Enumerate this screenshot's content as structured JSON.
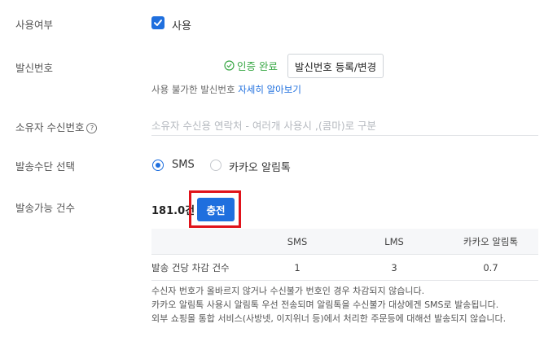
{
  "fields": {
    "usage_label": "사용여부",
    "sender_label": "발신번호",
    "owner_label": "소유자 수신번호",
    "method_label": "발송수단 선택",
    "count_label": "발송가능 건수"
  },
  "usage": {
    "checked": true,
    "checkbox_label": "사용"
  },
  "sender": {
    "status": "인증 완료",
    "register_button": "발신번호 등록/변경",
    "help_text": "사용 불가한 발신번호",
    "help_link": "자세히 알아보기"
  },
  "owner_input": {
    "value": "",
    "placeholder": "소유자 수신용 연락처 - 여러개 사용시 ,(콤마)로 구분"
  },
  "method": {
    "options": [
      {
        "label": "SMS",
        "selected": true
      },
      {
        "label": "카카오 알림톡",
        "selected": false
      }
    ]
  },
  "count": {
    "value": "181.0건",
    "charge_button": "충전"
  },
  "cost_table": {
    "headers": [
      "",
      "SMS",
      "LMS",
      "카카오 알림톡"
    ],
    "rows": [
      {
        "label": "발송 건당 차감 건수",
        "values": [
          "1",
          "3",
          "0.7"
        ]
      }
    ]
  },
  "notes": [
    "수신자 번호가 올바르지 않거나 수신불가 번호인 경우 차감되지 않습니다.",
    "카카오 알림톡 사용시 알림톡 우선 전송되며 알림톡을 수신불가 대상에겐 SMS로 발송됩니다.",
    "외부 쇼핑몰 통합 서비스(사방넷, 이지위너 등)에서 처리한 주문등에 대해선 발송되지 않습니다."
  ],
  "colors": {
    "accent": "#1f6fde",
    "success": "#3aa846",
    "highlight": "#e0131b"
  }
}
